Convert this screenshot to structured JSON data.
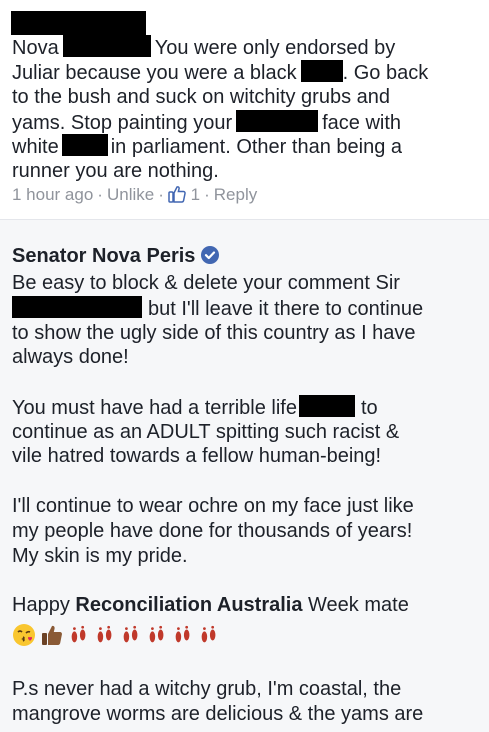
{
  "comment": {
    "l1_a": "Nova",
    "l1_b": "You were only endorsed by",
    "l2_a": "Juliar because you were a black",
    "l2_b": ". Go back",
    "l3": "to the bush and suck on witchity grubs and",
    "l4_a": "yams. Stop painting your",
    "l4_b": "face with",
    "l5_a": "white",
    "l5_b": "in parliament. Other than being a",
    "l6": "runner you are nothing.",
    "time": "1 hour ago",
    "unlike": "Unlike",
    "like_count": "1",
    "reply": "Reply",
    "sep": "·"
  },
  "reply": {
    "author": "Senator Nova Peris",
    "p1_l1": "Be easy to block & delete your comment Sir",
    "p1_l2": "but I'll leave it there to continue",
    "p1_l3": "to show the ugly side of this country as I have",
    "p1_l4": "always done!",
    "p2_l1_a": "You must have had a terrible life",
    "p2_l1_b": "to",
    "p2_l2": "continue as an ADULT spitting such racist &",
    "p2_l3": "vile hatred towards a fellow human-being!",
    "p3_l1": "I'll continue to wear ochre on my face just like",
    "p3_l2": "my people have done for thousands of years!",
    "p3_l3": "My skin is my pride.",
    "p4_a": "Happy",
    "p4_b": "Reconciliation Australia",
    "p4_c": "Week mate",
    "p5_l1": "P.s never had a witchy grub, I'm coastal, the",
    "p5_l2": "mangrove worms are delicious & the yams are"
  },
  "icons": [
    "thumbs-up-icon",
    "verified-badge-icon",
    "kissing-face-emoji",
    "thumbs-up-emoji",
    "footprints-emoji"
  ]
}
